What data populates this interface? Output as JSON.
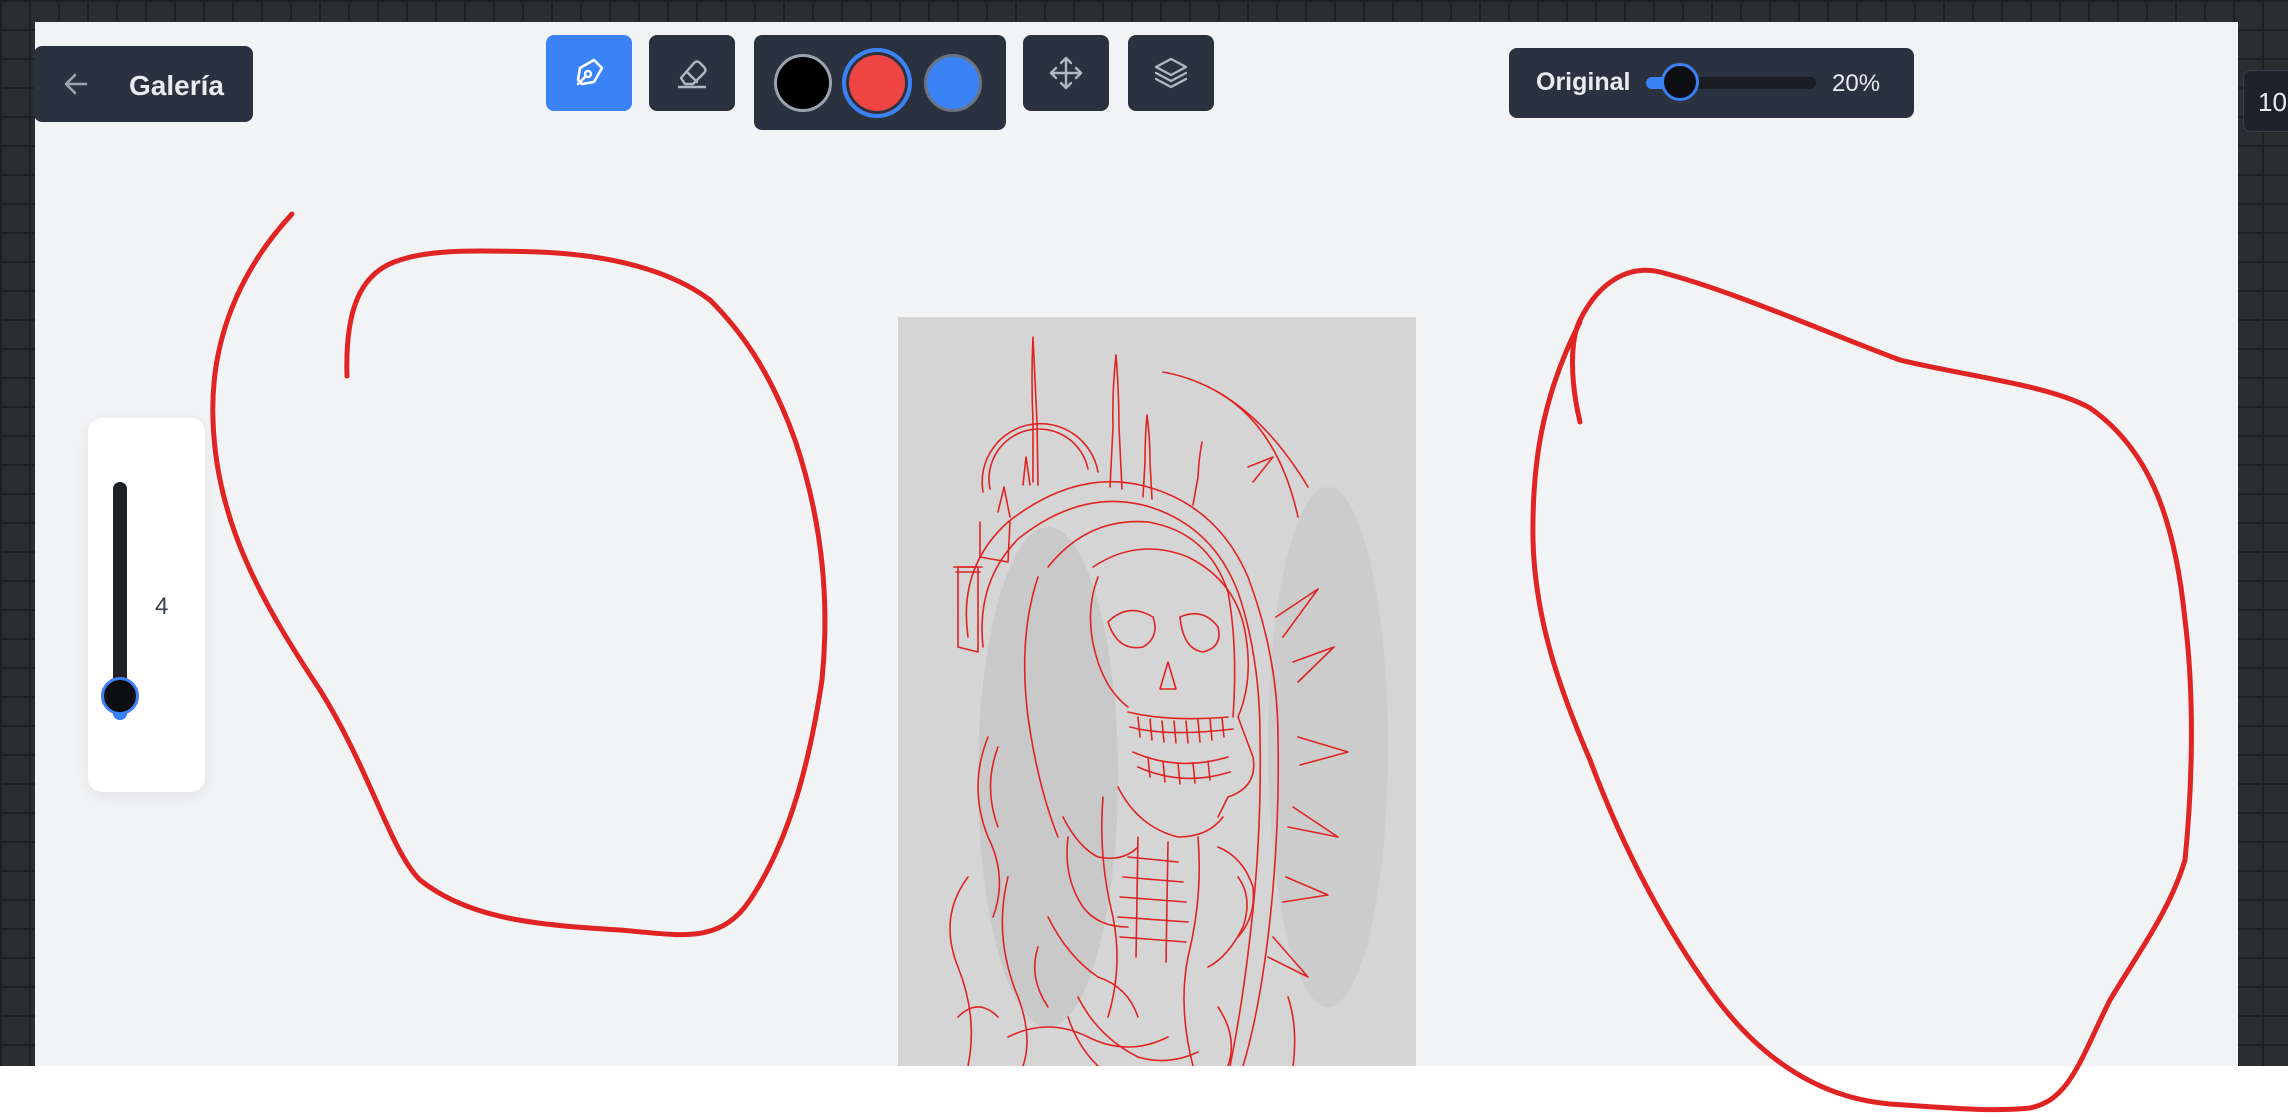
{
  "header": {
    "back_label": "Galería"
  },
  "toolbar": {
    "tools": [
      {
        "name": "pen",
        "icon": "pen-icon",
        "active": true
      },
      {
        "name": "eraser",
        "icon": "eraser-icon",
        "active": false
      },
      {
        "name": "move",
        "icon": "move-icon",
        "active": false
      },
      {
        "name": "layers",
        "icon": "layers-icon",
        "active": false
      }
    ],
    "colors": [
      "#000000",
      "#ef4444",
      "#3b82f6"
    ],
    "selected_color": "#ef4444"
  },
  "original_opacity": {
    "label": "Original",
    "value_text": "20%",
    "value": 0.2
  },
  "brush_size": {
    "value_text": "4",
    "value": 4,
    "level": 0.1
  },
  "edge_chip": {
    "text": "10"
  },
  "theme": {
    "accent": "#3b82f6",
    "stroke": "#e02424",
    "panel": "#2a3240",
    "canvas": "#f2f3f5"
  }
}
